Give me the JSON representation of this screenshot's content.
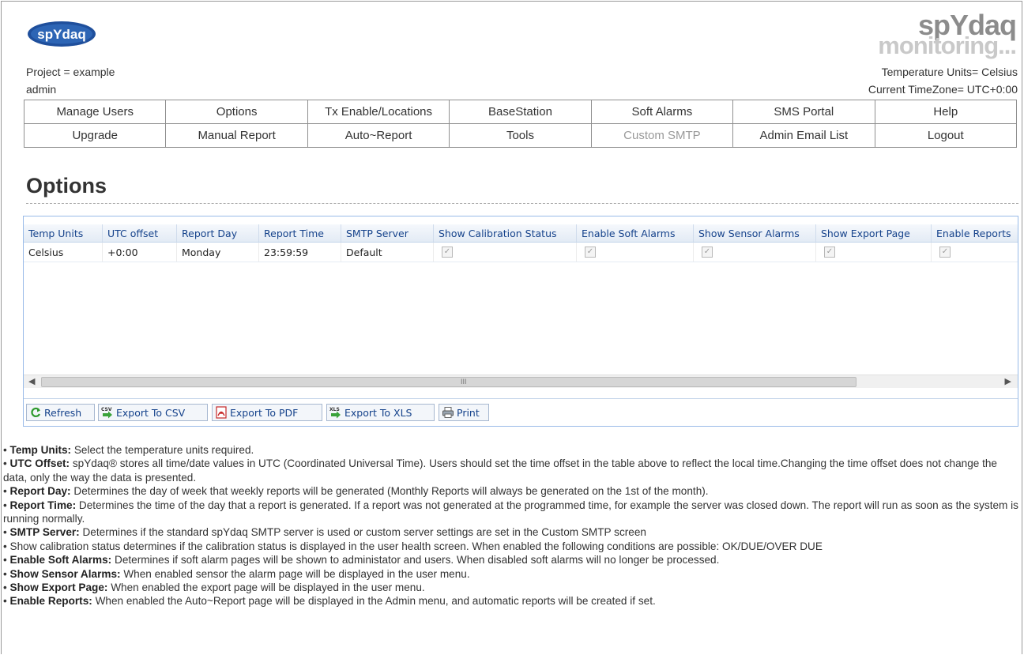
{
  "header": {
    "logo_text": "spYdaq",
    "brand_line1": "spYdaq",
    "brand_line2": "monitoring...",
    "project_line": "Project = example",
    "user_line": "admin",
    "temp_units_line": "Temperature Units= Celsius",
    "timezone_line": "Current TimeZone= UTC+0:00"
  },
  "menu": {
    "row1": [
      "Manage Users",
      "Options",
      "Tx Enable/Locations",
      "BaseStation",
      "Soft Alarms",
      "SMS Portal",
      "Help"
    ],
    "row2": [
      "Upgrade",
      "Manual Report",
      "Auto~Report",
      "Tools",
      "Custom SMTP",
      "Admin Email List",
      "Logout"
    ]
  },
  "page": {
    "title": "Options"
  },
  "grid": {
    "columns": [
      "Temp Units",
      "UTC offset",
      "Report Day",
      "Report Time",
      "SMTP Server",
      "Show Calibration Status",
      "Enable Soft Alarms",
      "Show Sensor Alarms",
      "Show Export Page",
      "Enable Reports"
    ],
    "row": {
      "temp_units": "Celsius",
      "utc_offset": "+0:00",
      "report_day": "Monday",
      "report_time": "23:59:59",
      "smtp_server": "Default",
      "show_calibration_status": true,
      "enable_soft_alarms": true,
      "show_sensor_alarms": true,
      "show_export_page": true,
      "enable_reports": true
    },
    "scroll_grip": "III"
  },
  "toolbar": {
    "refresh": "Refresh",
    "export_csv": "Export To CSV",
    "export_pdf": "Export To PDF",
    "export_xls": "Export To XLS",
    "print": "Print",
    "csv_icon_text": "CSV",
    "xls_icon_text": "XLS"
  },
  "descriptions": [
    {
      "label": "Temp Units:",
      "text": "  Select the temperature units required."
    },
    {
      "label": "UTC Offset:",
      "text": "  spYdaq® stores all time/date values in UTC (Coordinated Universal Time). Users should set the time offset in the table above to reflect the local time.Changing the time offset does not change the data, only the way the data is presented."
    },
    {
      "label": "Report Day:",
      "text": "  Determines the day of week that weekly reports will be generated (Monthly Reports will always be generated on the 1st of the month)."
    },
    {
      "label": "Report Time:",
      "text": "  Determines the time of the day that a report is generated. If a report was not generated at the programmed time, for example the server was closed down. The report will run as soon as the system is running normally."
    },
    {
      "label": "SMTP Server:",
      "text": "  Determines if the standard spYdaq SMTP server is used or custom server settings are set in the Custom SMTP screen"
    },
    {
      "label": "",
      "text": "  Show calibration status determines if the calibration status is displayed in the user health screen. When enabled the following conditions are possible: OK/DUE/OVER DUE"
    },
    {
      "label": "Enable Soft Alarms:",
      "text": "  Determines if soft alarm pages will be shown to administator and users. When disabled soft alarms will no longer be processed."
    },
    {
      "label": "Show Sensor Alarms:",
      "text": "  When enabled sensor the alarm page will be displayed in the user menu."
    },
    {
      "label": "Show Export Page:",
      "text": "  When enabled the export page will be displayed in the user menu."
    },
    {
      "label": "Enable Reports:",
      "text": "  When enabled the Auto~Report page will be displayed in the Admin menu, and automatic reports will be created if set."
    }
  ],
  "colors": {
    "grid_header_text": "#15428b",
    "logo_blue": "#1f4f9c",
    "brand_gray": "#8c8c8c",
    "disabled_menu": "#999999"
  }
}
